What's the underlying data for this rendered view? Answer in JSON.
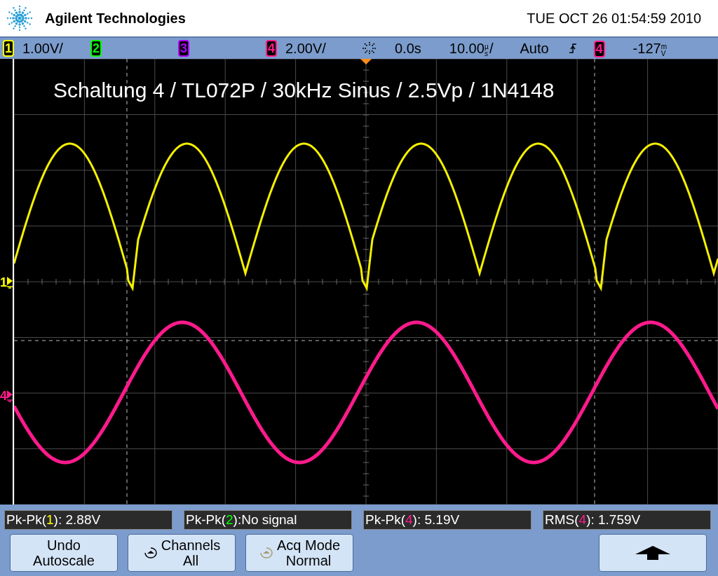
{
  "header": {
    "brand": "Agilent Technologies",
    "datetime": "TUE OCT 26 01:54:59 2010"
  },
  "channel_bar": {
    "channels": [
      {
        "number": "1",
        "color": "#ffff00",
        "scale": "1.00V/"
      },
      {
        "number": "2",
        "color": "#00ff00"
      },
      {
        "number": "3",
        "color": "#b000ff"
      },
      {
        "number": "4",
        "color": "#ff1a8c",
        "scale": "2.00V/"
      }
    ],
    "delay": "0.0s",
    "timebase": "10.00",
    "timebase_unit": "µs",
    "timebase_suffix": "/",
    "trigger_mode": "Auto",
    "trigger_source": {
      "number": "4",
      "color": "#ff1a8c"
    },
    "trigger_level": "-127",
    "trigger_unit": "mV"
  },
  "annotation": "Schaltung 4 / TL072P / 30kHz Sinus / 2.5Vp / 1N4148",
  "markers": [
    {
      "number": "1",
      "color": "#ffff00"
    },
    {
      "number": "4",
      "color": "#ff1a8c"
    }
  ],
  "measurements": [
    {
      "prefix": "Pk-Pk(",
      "channel": "1",
      "color": "#ffff00",
      "suffix": "): 2.88V"
    },
    {
      "prefix": "Pk-Pk(",
      "channel": "2",
      "color": "#00ff00",
      "suffix": "):No signal"
    },
    {
      "prefix": "Pk-Pk(",
      "channel": "4",
      "color": "#ff1a8c",
      "suffix": "): 5.19V"
    },
    {
      "prefix": "RMS(",
      "channel": "4",
      "color": "#ff1a8c",
      "suffix": "): 1.759V"
    }
  ],
  "softkeys": [
    {
      "kind": "plain",
      "lines": [
        "Undo",
        "Autoscale"
      ]
    },
    {
      "kind": "knob",
      "lines": [
        "Channels",
        "All"
      ]
    },
    {
      "kind": "knob_dimmed",
      "lines": [
        "Acq Mode",
        "Normal"
      ]
    },
    {
      "kind": "empty"
    },
    {
      "kind": "empty"
    },
    {
      "kind": "arrow"
    }
  ]
}
